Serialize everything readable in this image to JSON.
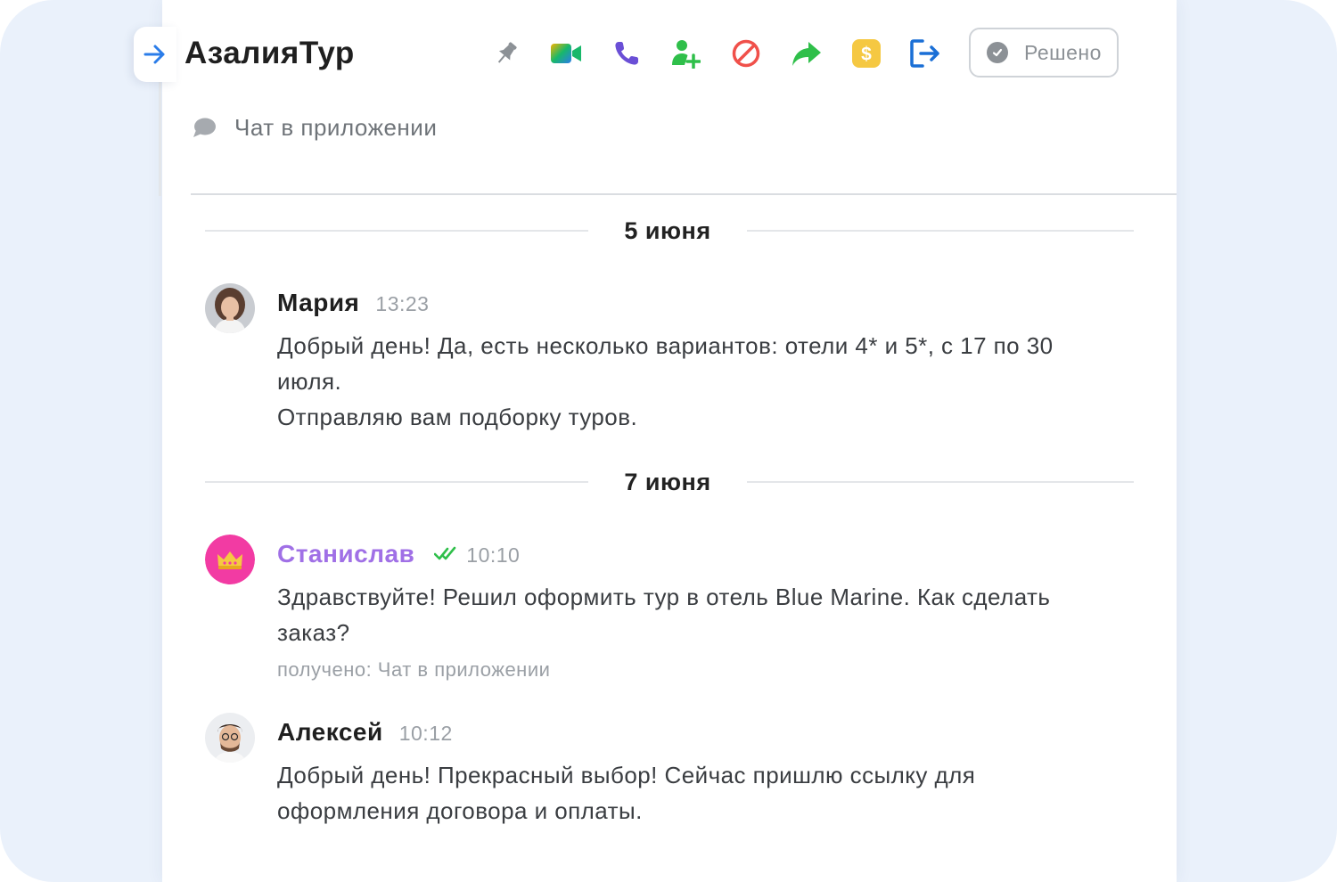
{
  "header": {
    "title": "АзалияТур",
    "resolved_label": "Решено",
    "channel_label": "Чат в приложении",
    "toolbar_icons": [
      "pin-icon",
      "video-call-icon",
      "phone-icon",
      "add-user-icon",
      "block-icon",
      "forward-icon",
      "payment-icon",
      "exit-icon"
    ]
  },
  "colors": {
    "back_arrow": "#2b7de9",
    "client_name": "#a070e6",
    "delivered_check": "#2fbf4a",
    "video": "#18b86a",
    "phone": "#6a4fd6",
    "add_user": "#2fbf4a",
    "block": "#f0504a",
    "forward": "#2fbf4a",
    "payment": "#f5c842",
    "exit": "#1a6fd6",
    "client_avatar": "#f23ba3"
  },
  "conversation": {
    "dates": [
      "5 июня",
      "7 июня"
    ],
    "messages": [
      {
        "author": "Мария",
        "time": "13:23",
        "lines": [
          "Добрый день! Да, есть несколько вариантов: отели 4* и 5*, с 17 по 30 июля.",
          "Отправляю вам подборку туров."
        ]
      },
      {
        "author": "Станислав",
        "time": "10:10",
        "lines": [
          "Здравствуйте! Решил оформить тур в отель Blue Marine. Как сделать заказ?"
        ],
        "meta": "получено: Чат в приложении"
      },
      {
        "author": "Алексей",
        "time": "10:12",
        "lines": [
          "Добрый день! Прекрасный выбор! Сейчас пришлю ссылку для оформления договора и оплаты."
        ]
      }
    ]
  }
}
